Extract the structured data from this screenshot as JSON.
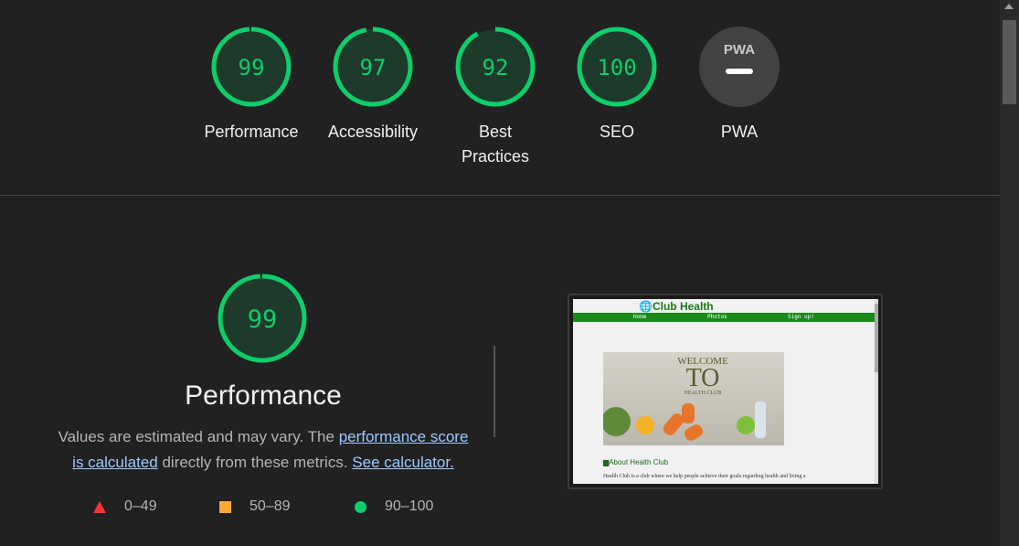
{
  "summary": {
    "categories": [
      {
        "score": "99",
        "label": "Performance",
        "value": 0.99
      },
      {
        "score": "97",
        "label": "Accessibility",
        "value": 0.97
      },
      {
        "score": "92",
        "label": "Best Practices",
        "value": 0.92
      },
      {
        "score": "100",
        "label": "SEO",
        "value": 1.0
      },
      {
        "score": "",
        "label": "PWA",
        "badge": "PWA"
      }
    ]
  },
  "performance": {
    "score": "99",
    "value": 0.99,
    "title": "Performance",
    "desc_prefix": "Values are estimated and may vary. The ",
    "link_score": "performance score is calculated",
    "desc_middle": " directly from these metrics. ",
    "link_calculator": "See calculator."
  },
  "legend": [
    {
      "label": "0–49",
      "shape": "triangle",
      "color": "#ff3333"
    },
    {
      "label": "50–89",
      "shape": "square",
      "color": "#ffa733"
    },
    {
      "label": "90–100",
      "shape": "circle",
      "color": "#0cce6b"
    }
  ],
  "colors": {
    "pass": "#0cce6b",
    "gauge_bg": "#1e3a2a",
    "pwa_bg": "#424242"
  },
  "screenshot": {
    "logo": "Club Health",
    "nav": [
      "Home",
      "Photos",
      "Sign up!"
    ],
    "hero_line1": "WELCOME",
    "hero_line2": "TO",
    "hero_line3": "HEALTH CLUB",
    "about_heading": "About Health Club",
    "about_text": "Health Club is a club where we help people achieve their goals regarding health and living a"
  }
}
